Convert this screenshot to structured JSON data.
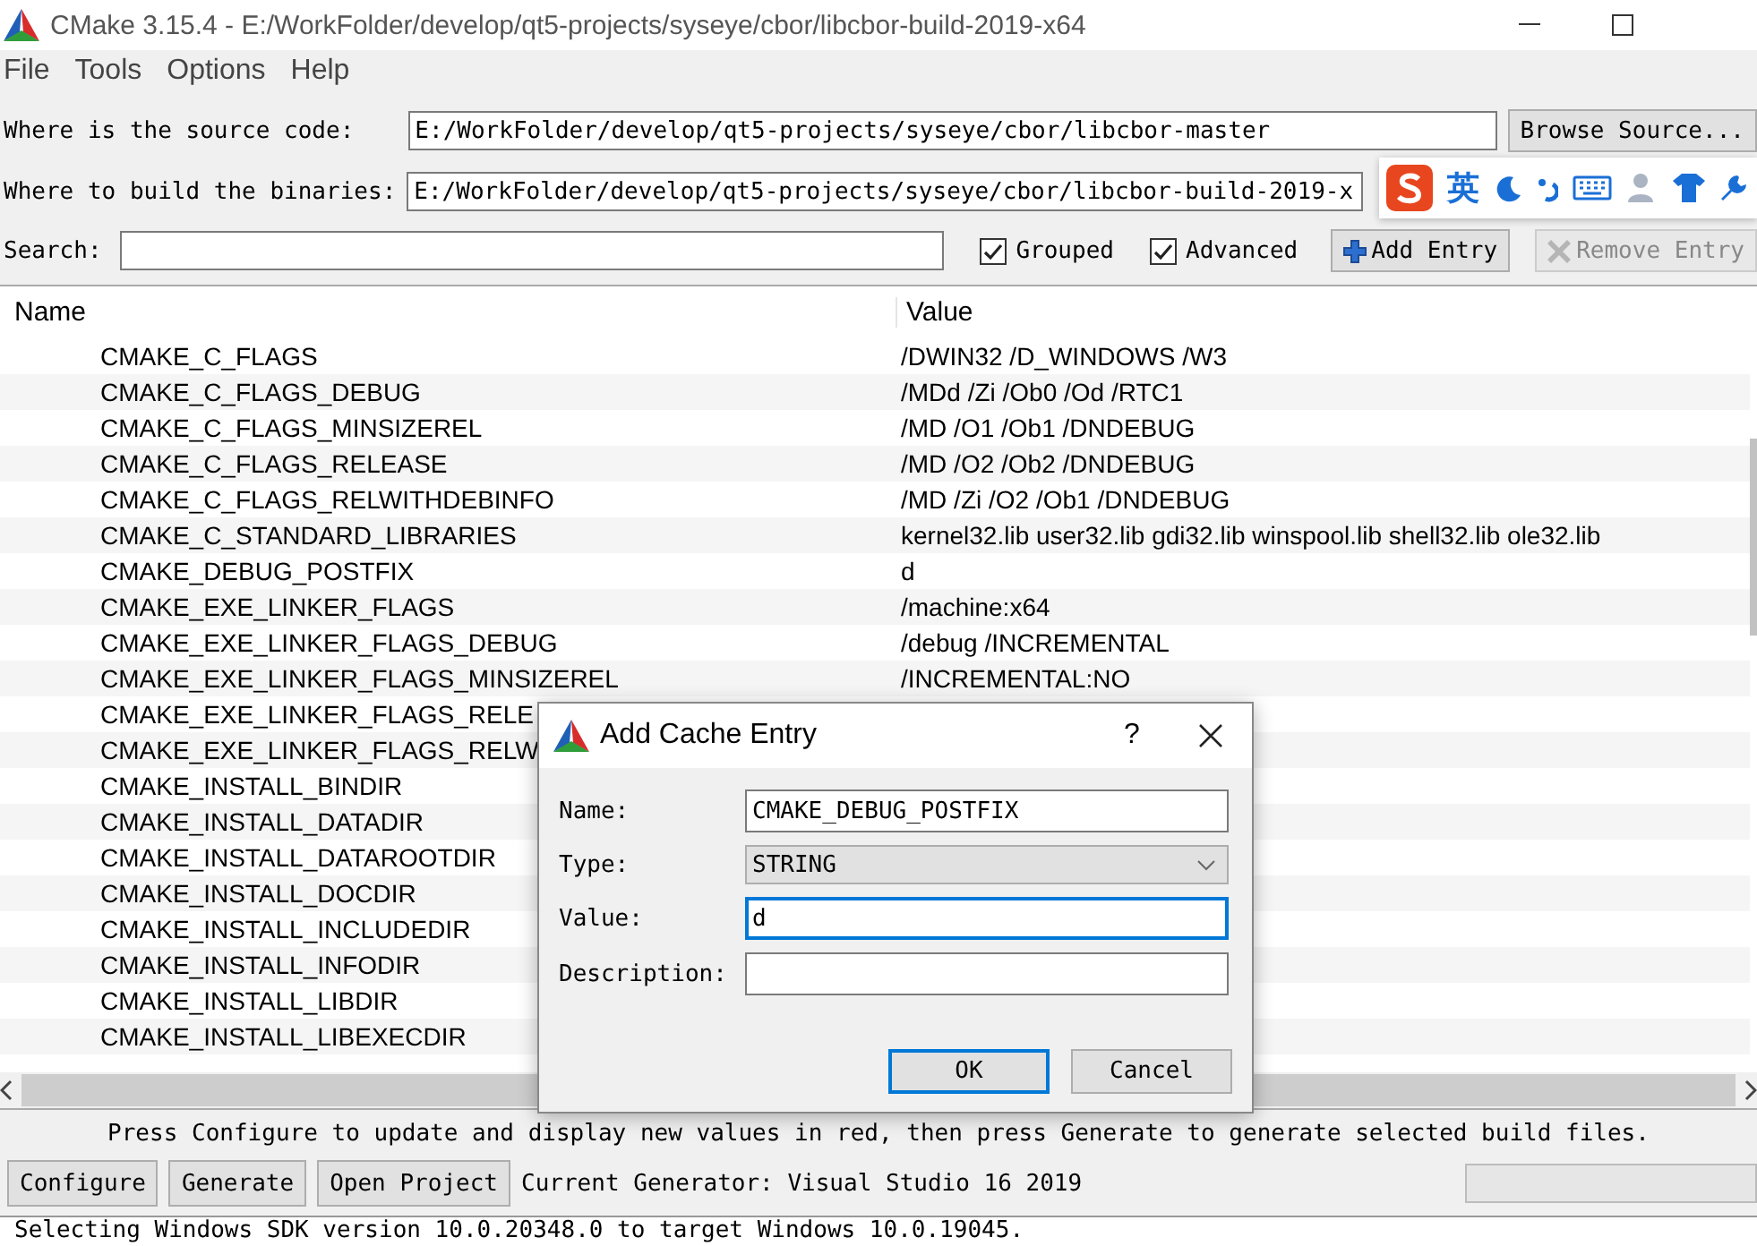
{
  "window": {
    "title": "CMake 3.15.4 - E:/WorkFolder/develop/qt5-projects/syseye/cbor/libcbor-build-2019-x64"
  },
  "menu": [
    "File",
    "Tools",
    "Options",
    "Help"
  ],
  "source": {
    "label": "Where is the source code:",
    "value": "E:/WorkFolder/develop/qt5-projects/syseye/cbor/libcbor-master",
    "button": "Browse Source..."
  },
  "build": {
    "label": "Where to build the binaries:",
    "value": "E:/WorkFolder/develop/qt5-projects/syseye/cbor/libcbor-build-2019-x"
  },
  "ime_toolbar": {
    "mode": "英"
  },
  "search": {
    "label": "Search:"
  },
  "options": [
    {
      "label": "Grouped",
      "checked": true
    },
    {
      "label": "Advanced",
      "checked": true
    }
  ],
  "entry_buttons": [
    {
      "label": "Add Entry",
      "kind": "add",
      "disabled": false
    },
    {
      "label": "Remove Entry",
      "kind": "remove",
      "disabled": true
    }
  ],
  "table": {
    "columns": [
      "Name",
      "Value"
    ],
    "rows": [
      {
        "name": "CMAKE_C_FLAGS",
        "value": "/DWIN32 /D_WINDOWS /W3"
      },
      {
        "name": "CMAKE_C_FLAGS_DEBUG",
        "value": "/MDd /Zi /Ob0 /Od /RTC1"
      },
      {
        "name": "CMAKE_C_FLAGS_MINSIZEREL",
        "value": "/MD /O1 /Ob1 /DNDEBUG"
      },
      {
        "name": "CMAKE_C_FLAGS_RELEASE",
        "value": "/MD /O2 /Ob2 /DNDEBUG"
      },
      {
        "name": "CMAKE_C_FLAGS_RELWITHDEBINFO",
        "value": "/MD /Zi /O2 /Ob1 /DNDEBUG"
      },
      {
        "name": "CMAKE_C_STANDARD_LIBRARIES",
        "value": "kernel32.lib user32.lib gdi32.lib winspool.lib shell32.lib ole32.lib"
      },
      {
        "name": "CMAKE_DEBUG_POSTFIX",
        "value": "d"
      },
      {
        "name": "CMAKE_EXE_LINKER_FLAGS",
        "value": "/machine:x64"
      },
      {
        "name": "CMAKE_EXE_LINKER_FLAGS_DEBUG",
        "value": "/debug /INCREMENTAL"
      },
      {
        "name": "CMAKE_EXE_LINKER_FLAGS_MINSIZEREL",
        "value": "/INCREMENTAL:NO"
      },
      {
        "name": "CMAKE_EXE_LINKER_FLAGS_RELE"
      },
      {
        "name": "CMAKE_EXE_LINKER_FLAGS_RELW"
      },
      {
        "name": "CMAKE_INSTALL_BINDIR"
      },
      {
        "name": "CMAKE_INSTALL_DATADIR"
      },
      {
        "name": "CMAKE_INSTALL_DATAROOTDIR"
      },
      {
        "name": "CMAKE_INSTALL_DOCDIR"
      },
      {
        "name": "CMAKE_INSTALL_INCLUDEDIR"
      },
      {
        "name": "CMAKE_INSTALL_INFODIR"
      },
      {
        "name": "CMAKE_INSTALL_LIBDIR"
      },
      {
        "name": "CMAKE_INSTALL_LIBEXECDIR"
      }
    ]
  },
  "message": "Press Configure to update and display new values in red, then press Generate to generate selected build files.",
  "actions": [
    "Configure",
    "Generate",
    "Open Project"
  ],
  "generator": "Current Generator: Visual Studio 16 2019",
  "progress": {
    "level": 0
  },
  "output": "Selecting Windows SDK version 10.0.20348.0 to target Windows 10.0.19045.",
  "dialog": {
    "title": "Add Cache Entry",
    "help": "?",
    "fields": [
      {
        "label": "Name:",
        "kind": "text",
        "value": "CMAKE_DEBUG_POSTFIX",
        "focused": false
      },
      {
        "label": "Type:",
        "kind": "select",
        "value": "STRING"
      },
      {
        "label": "Value:",
        "kind": "text",
        "value": "d",
        "focused": true
      },
      {
        "label": "Description:",
        "kind": "text",
        "focused": false
      }
    ],
    "buttons": [
      {
        "label": "OK",
        "default": true
      },
      {
        "label": "Cancel",
        "default": false
      }
    ]
  }
}
